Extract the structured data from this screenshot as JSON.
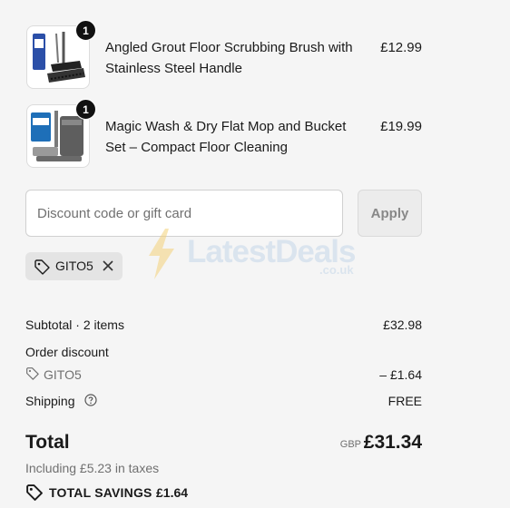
{
  "items": [
    {
      "name": "Angled Grout Floor Scrubbing Brush with Stainless Steel Handle",
      "price": "£12.99",
      "quantity": "1",
      "image_icon": "scrubbing-brush-image"
    },
    {
      "name": "Magic Wash & Dry Flat Mop and Bucket Set – Compact Floor Cleaning",
      "price": "£19.99",
      "quantity": "1",
      "image_icon": "mop-bucket-image"
    }
  ],
  "discount": {
    "placeholder": "Discount code or gift card",
    "value": "",
    "apply_label": "Apply",
    "applied_code": "GITO5"
  },
  "watermark": {
    "text": "LatestDeals",
    "sub": ".co.uk"
  },
  "summary": {
    "subtotal_label": "Subtotal · 2 items",
    "subtotal_value": "£32.98",
    "order_discount_label": "Order discount",
    "discount_code": "GITO5",
    "discount_value": "– £1.64",
    "shipping_label": "Shipping",
    "shipping_value": "FREE",
    "total_label": "Total",
    "currency": "GBP",
    "total_value": "£31.34",
    "taxes_note": "Including £5.23 in taxes",
    "savings_label": "TOTAL SAVINGS",
    "savings_value": "£1.64"
  },
  "colors": {
    "background": "#f5f5f5",
    "badge": "#111111",
    "chip": "#e4e4e4",
    "muted_text": "#707070"
  }
}
